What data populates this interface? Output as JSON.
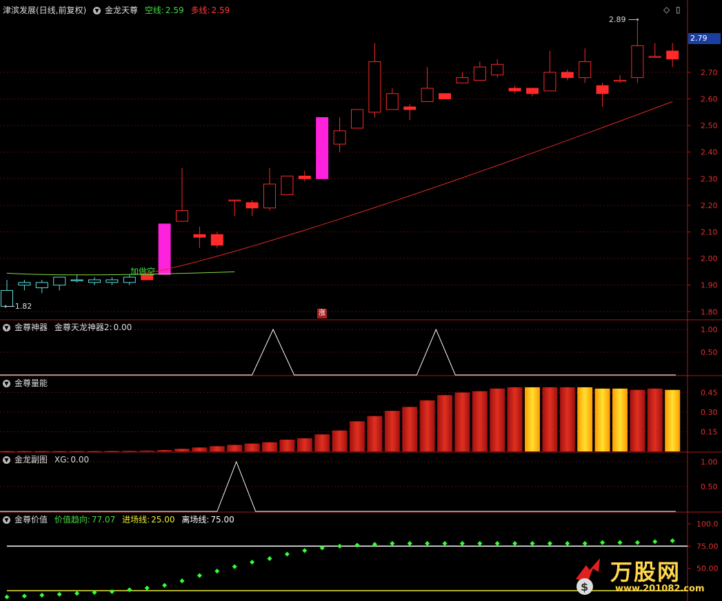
{
  "main": {
    "title": "津滨发展(日线,前复权)",
    "indicator": "金龙天尊",
    "kong_label": "空线:",
    "kong_value": "2.59",
    "duo_label": "多线:",
    "duo_value": "2.59",
    "high_mark": "2.89",
    "low_mark": "1.82",
    "signal_text": "加做空",
    "zhang_badge": "涨",
    "price_tag": "2.79",
    "y_ticks": [
      "2.70",
      "2.60",
      "2.50",
      "2.40",
      "2.30",
      "2.20",
      "2.10",
      "2.00",
      "1.90",
      "1.80"
    ]
  },
  "sub1": {
    "title": "金尊神器",
    "field_label": "金尊天龙神器2:",
    "field_value": "0.00",
    "y_ticks": [
      "1.00",
      "0.50"
    ]
  },
  "sub2": {
    "title": "金尊量能",
    "y_ticks": [
      "0.45",
      "0.30",
      "0.15"
    ]
  },
  "sub3": {
    "title": "金龙副图",
    "field_label": "XG:",
    "field_value": "0.00",
    "y_ticks": [
      "1.00",
      "0.50"
    ]
  },
  "sub4": {
    "title": "金尊价值",
    "v1_label": "价值趋向:",
    "v1_value": "77.07",
    "v2_label": "进场线:",
    "v2_value": "25.00",
    "v3_label": "离场线:",
    "v3_value": "75.00",
    "y_ticks": [
      "100.0",
      "75.00",
      "50.00"
    ]
  },
  "logo": {
    "name": "万股网",
    "url": "www.201082.com"
  },
  "chart_data": {
    "type": "candlestick",
    "ylim": [
      1.78,
      2.92
    ],
    "candles": [
      [
        1.88,
        1.82,
        1.92,
        1.82
      ],
      [
        1.9,
        1.91,
        1.92,
        1.88
      ],
      [
        1.89,
        1.91,
        1.92,
        1.87
      ],
      [
        1.9,
        1.93,
        1.93,
        1.88
      ],
      [
        1.92,
        1.92,
        1.94,
        1.91
      ],
      [
        1.91,
        1.92,
        1.93,
        1.9
      ],
      [
        1.91,
        1.92,
        1.93,
        1.9
      ],
      [
        1.91,
        1.93,
        1.94,
        1.9
      ],
      [
        1.94,
        1.92,
        1.95,
        1.92
      ],
      [
        1.94,
        2.13,
        2.13,
        1.94
      ],
      [
        2.14,
        2.18,
        2.34,
        2.14
      ],
      [
        2.09,
        2.08,
        2.12,
        2.04
      ],
      [
        2.09,
        2.05,
        2.1,
        2.04
      ],
      [
        2.22,
        2.22,
        2.22,
        2.16
      ],
      [
        2.21,
        2.19,
        2.22,
        2.16
      ],
      [
        2.19,
        2.28,
        2.34,
        2.18
      ],
      [
        2.24,
        2.31,
        2.31,
        2.24
      ],
      [
        2.31,
        2.3,
        2.33,
        2.29
      ],
      [
        2.3,
        2.53,
        2.53,
        2.3
      ],
      [
        2.43,
        2.48,
        2.53,
        2.4
      ],
      [
        2.49,
        2.56,
        2.56,
        2.49
      ],
      [
        2.55,
        2.74,
        2.81,
        2.53
      ],
      [
        2.56,
        2.62,
        2.64,
        2.56
      ],
      [
        2.57,
        2.56,
        2.58,
        2.52
      ],
      [
        2.59,
        2.64,
        2.72,
        2.59
      ],
      [
        2.62,
        2.6,
        2.62,
        2.6
      ],
      [
        2.66,
        2.68,
        2.7,
        2.66
      ],
      [
        2.67,
        2.72,
        2.74,
        2.67
      ],
      [
        2.69,
        2.73,
        2.75,
        2.68
      ],
      [
        2.64,
        2.63,
        2.65,
        2.62
      ],
      [
        2.64,
        2.62,
        2.64,
        2.61
      ],
      [
        2.63,
        2.7,
        2.78,
        2.63
      ],
      [
        2.7,
        2.68,
        2.71,
        2.67
      ],
      [
        2.68,
        2.74,
        2.79,
        2.66
      ],
      [
        2.65,
        2.62,
        2.66,
        2.57
      ],
      [
        2.67,
        2.67,
        2.69,
        2.66
      ],
      [
        2.68,
        2.8,
        2.89,
        2.66
      ],
      [
        2.76,
        2.76,
        2.81,
        2.76
      ],
      [
        2.78,
        2.75,
        2.81,
        2.72
      ]
    ],
    "volume": [
      0.002,
      0.002,
      0.002,
      0.002,
      0.002,
      0.002,
      0.003,
      0.004,
      0.006,
      0.01,
      0.02,
      0.03,
      0.04,
      0.05,
      0.06,
      0.07,
      0.09,
      0.1,
      0.13,
      0.16,
      0.23,
      0.27,
      0.31,
      0.34,
      0.39,
      0.43,
      0.45,
      0.46,
      0.48,
      0.49,
      0.49,
      0.49,
      0.49,
      0.49,
      0.48,
      0.48,
      0.47,
      0.48,
      0.47
    ],
    "value_dots": [
      18,
      19,
      20,
      21,
      22,
      23,
      24,
      26,
      28,
      31,
      36,
      42,
      47,
      52,
      57,
      61,
      66,
      70,
      73,
      75,
      76,
      77,
      78,
      78,
      78,
      78,
      78,
      78,
      78,
      78,
      78,
      78,
      78,
      78,
      79,
      79,
      79,
      80,
      81
    ]
  }
}
